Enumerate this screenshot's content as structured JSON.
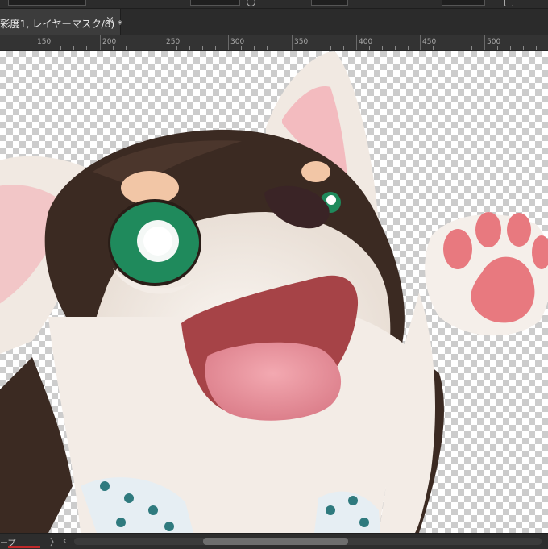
{
  "document_tab": {
    "title": "彩度1, レイヤーマスク/8) *",
    "close_glyph": "×"
  },
  "ruler": {
    "labels": [
      "150",
      "200",
      "250",
      "300",
      "350",
      "400",
      "450",
      "500"
    ]
  },
  "statusbar": {
    "text": "ープ",
    "scroll_left": "〉",
    "scroll_right": "‹"
  },
  "canvas": {
    "image_description_icon": "artwork-layer",
    "transparency": "checkerboard"
  },
  "colors": {
    "fur_dark": "#3b2a22",
    "fur_light": "#f3ece6",
    "tan": "#f2c6a6",
    "eye_green": "#1f8a5c",
    "tongue": "#e9909a",
    "paw_pad": "#e8797f"
  }
}
